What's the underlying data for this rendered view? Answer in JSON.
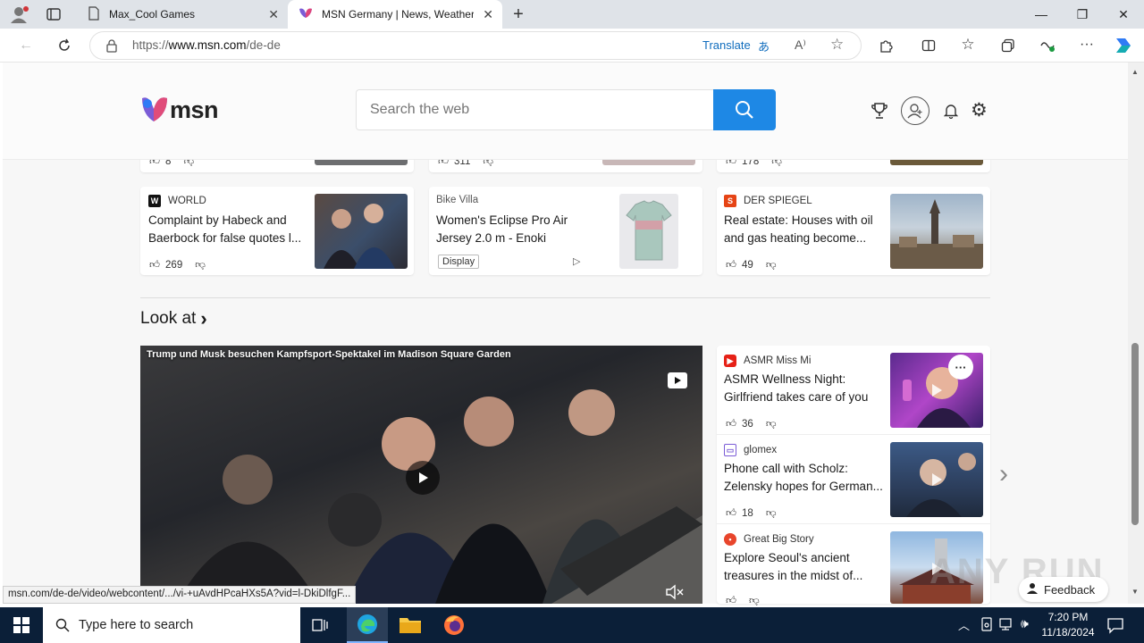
{
  "browser": {
    "tabs": [
      {
        "title": "Max_Cool Games"
      },
      {
        "title": "MSN Germany | News, Weather, W"
      }
    ],
    "url_prefix": "https://",
    "url_host": "www.msn.com",
    "url_path": "/de-de",
    "translate_label": "Translate",
    "status_url": "msn.com/de-de/video/webcontent/.../vi-+uAvdHPcaHXs5A?vid=l-DkiDlfgF..."
  },
  "header": {
    "logo_text": "msn",
    "search_placeholder": "Search the web"
  },
  "top_row_counts": [
    "8",
    "311",
    "178"
  ],
  "news_row": [
    {
      "source": "WORLD",
      "title": "Complaint by Habeck and Baerbock for false quotes l...",
      "likes": "269"
    },
    {
      "source": "Bike Villa",
      "title": "Women's Eclipse Pro Air Jersey 2.0 m - Enoki",
      "badge": "Display"
    },
    {
      "source": "DER SPIEGEL",
      "title": "Real estate: Houses with oil and gas heating become...",
      "likes": "49"
    }
  ],
  "section": {
    "title": "Look at",
    "chevron": "›"
  },
  "video": {
    "caption": "Trump und Musk besuchen Kampfsport-Spektakel im Madison Square Garden"
  },
  "side_list": [
    {
      "source": "ASMR Miss Mi",
      "title_line1": "ASMR Wellness Night:",
      "title_line2": "Girlfriend takes care of you",
      "likes": "36"
    },
    {
      "source": "glomex",
      "title_line1": "Phone call with Scholz:",
      "title_line2": "Zelensky hopes for German...",
      "likes": "18"
    },
    {
      "source": "Great Big Story",
      "title_line1": "Explore Seoul's ancient",
      "title_line2": "treasures in the midst of..."
    }
  ],
  "feedback_label": "Feedback",
  "watermark": "ANY RUN",
  "taskbar": {
    "search_placeholder": "Type here to search",
    "time": "7:20 PM",
    "date": "11/18/2024"
  },
  "colors": {
    "accent": "#0078d4",
    "taskbar": "#0b1f38"
  }
}
